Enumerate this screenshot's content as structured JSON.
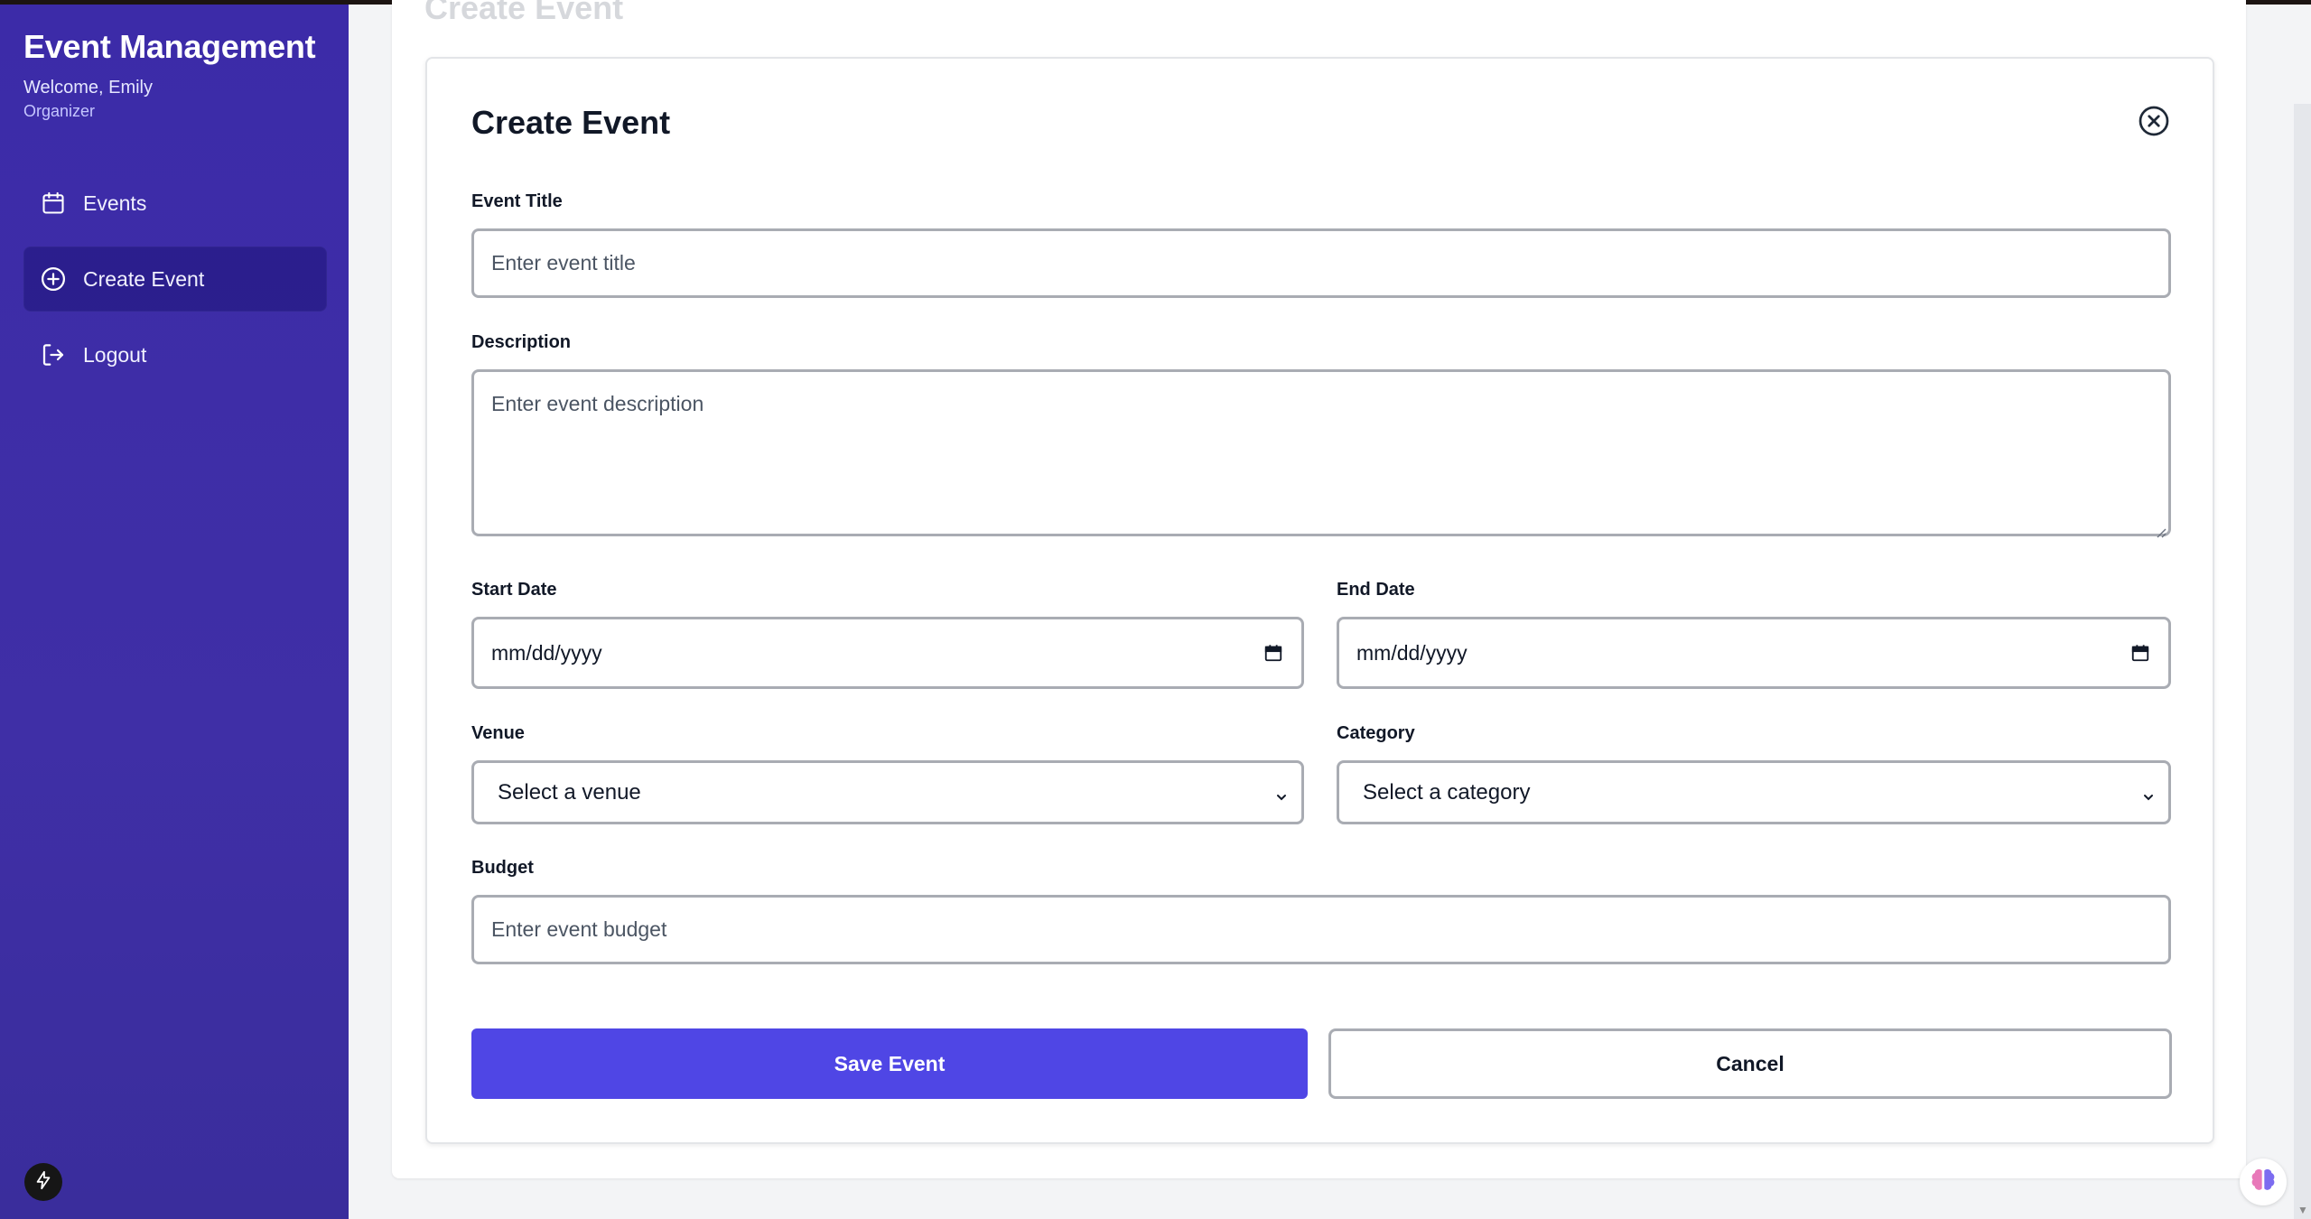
{
  "sidebar": {
    "title": "Event Management",
    "welcome": "Welcome, Emily",
    "role": "Organizer",
    "items": [
      {
        "label": "Events",
        "icon": "calendar-icon"
      },
      {
        "label": "Create Event",
        "icon": "plus-circle-icon",
        "active": true
      },
      {
        "label": "Logout",
        "icon": "logout-icon"
      }
    ]
  },
  "page": {
    "background_title": "Create Event"
  },
  "modal": {
    "title": "Create Event",
    "fields": {
      "title_label": "Event Title",
      "title_placeholder": "Enter event title",
      "description_label": "Description",
      "description_placeholder": "Enter event description",
      "start_label": "Start Date",
      "start_value": "mm/dd/yyyy",
      "end_label": "End Date",
      "end_value": "mm/dd/yyyy",
      "venue_label": "Venue",
      "venue_value": "Select a venue",
      "category_label": "Category",
      "category_value": "Select a category",
      "budget_label": "Budget",
      "budget_placeholder": "Enter event budget"
    },
    "save_label": "Save Event",
    "cancel_label": "Cancel"
  },
  "colors": {
    "sidebar": "#3c2ba8",
    "primary": "#4f46e5",
    "border": "#a9acb3"
  }
}
